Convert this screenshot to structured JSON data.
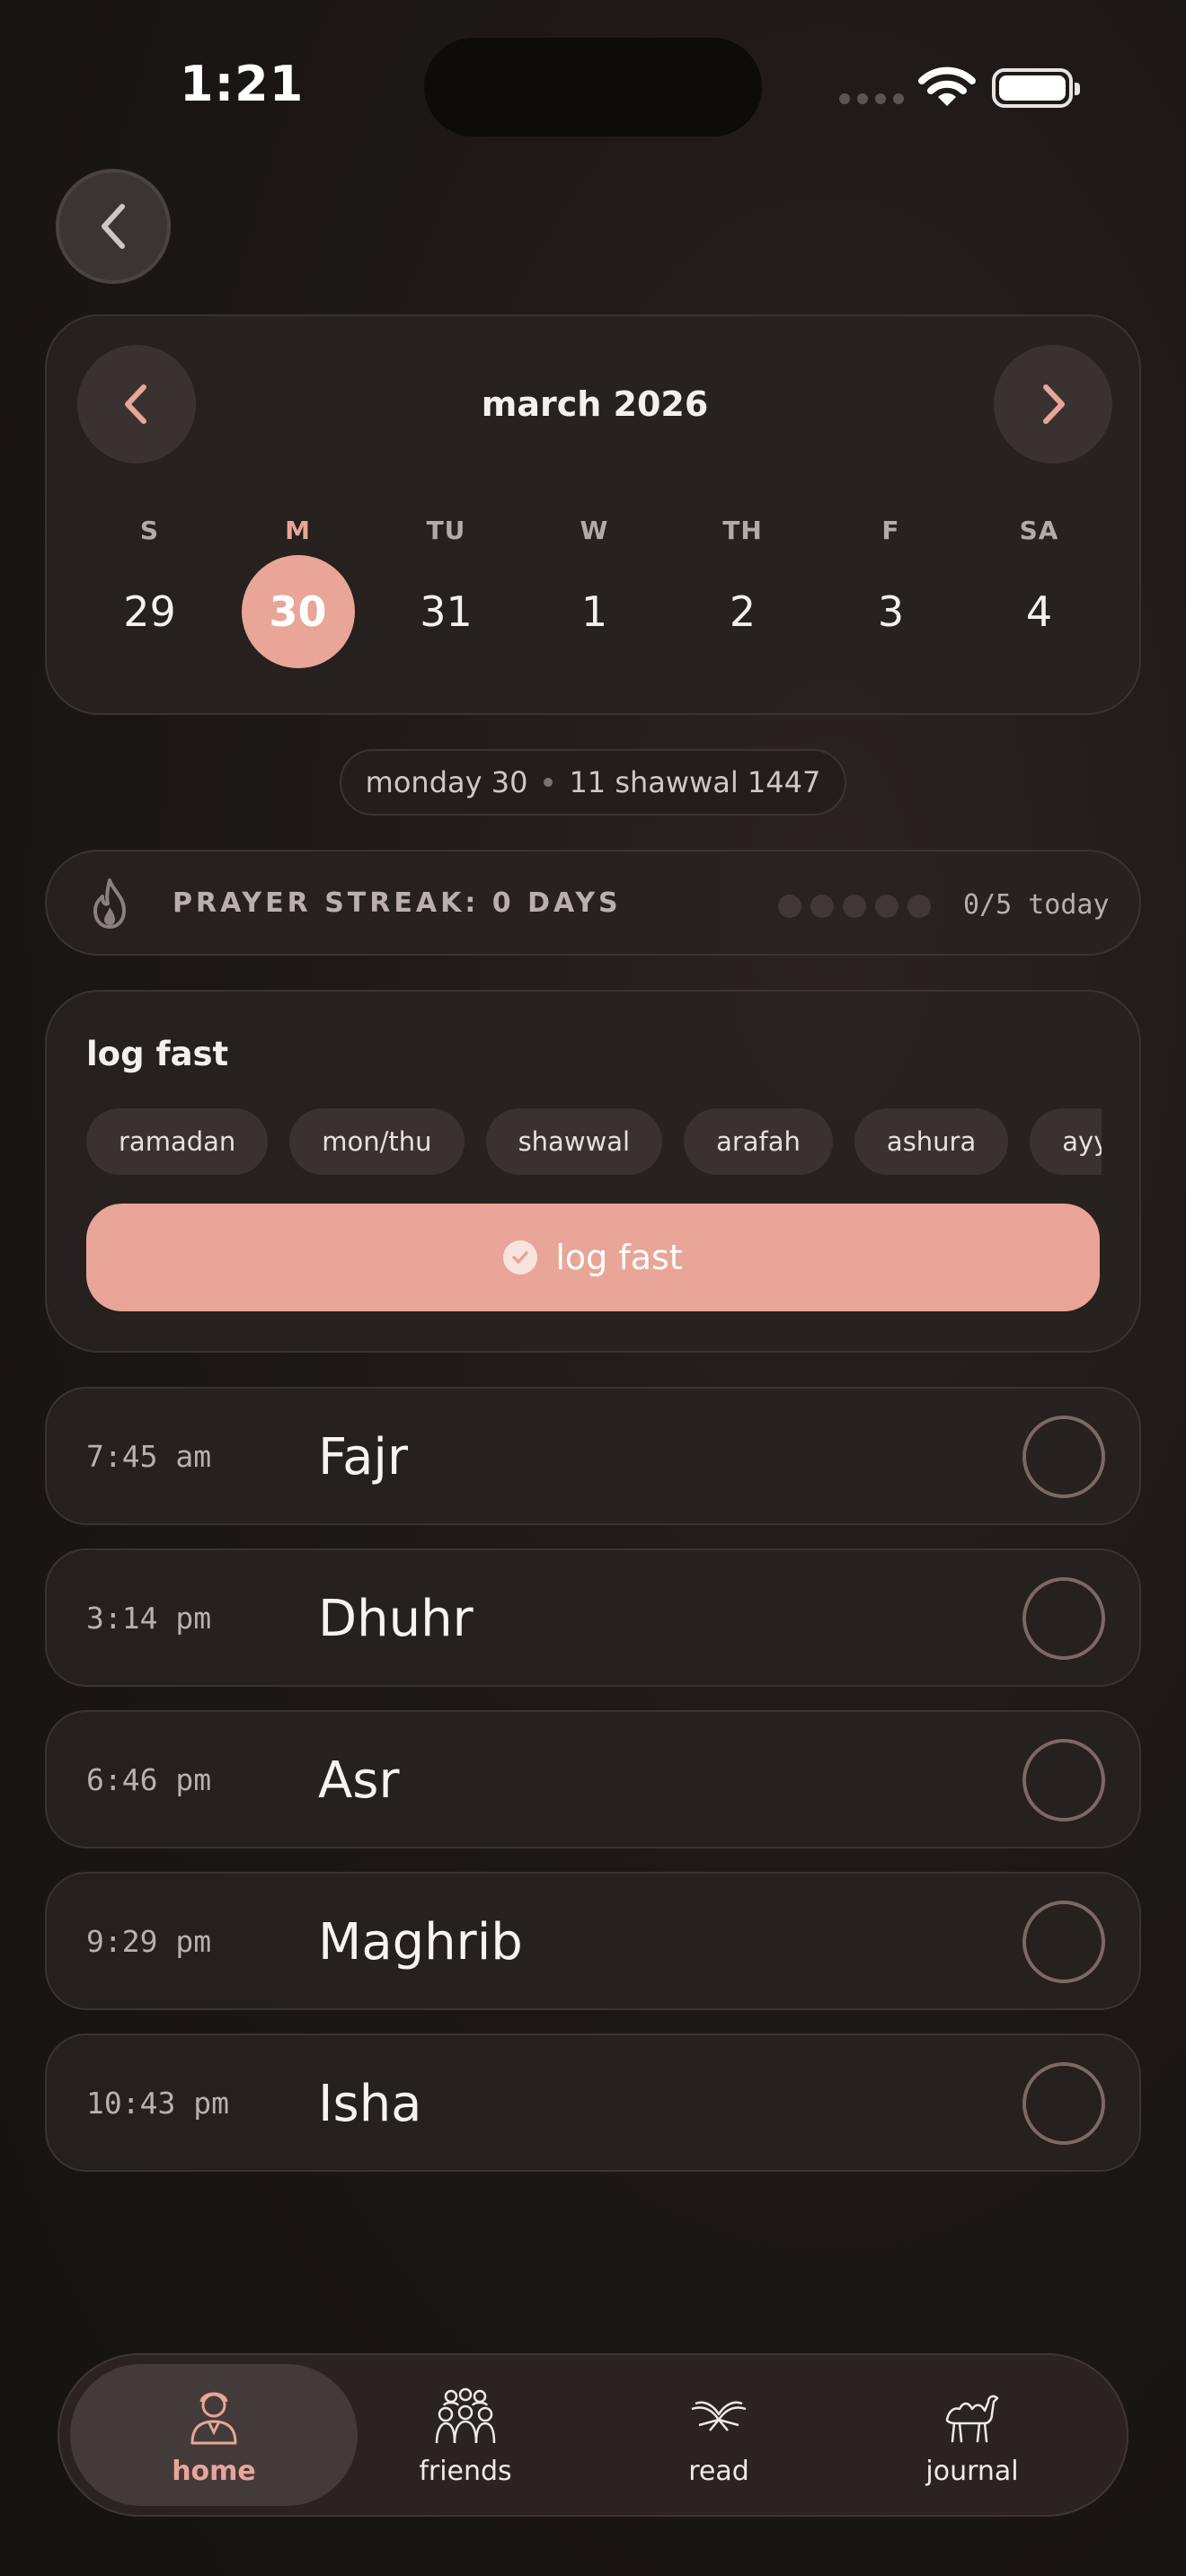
{
  "status_bar": {
    "time": "1:21"
  },
  "calendar": {
    "month_title": "march 2026",
    "weekdays": [
      "S",
      "M",
      "TU",
      "W",
      "TH",
      "F",
      "SA"
    ],
    "dates": [
      "29",
      "30",
      "31",
      "1",
      "2",
      "3",
      "4"
    ],
    "selected_index": 1,
    "accent_color": "#e9a598"
  },
  "date_info": {
    "gregorian": "monday 30",
    "hijri": "11 shawwal 1447"
  },
  "streak": {
    "label": "PRAYER STREAK: 0 DAYS",
    "completed": 0,
    "total": 5,
    "count_text": "0/5 today"
  },
  "log_fast": {
    "title": "log fast",
    "chips": [
      "ramadan",
      "mon/thu",
      "shawwal",
      "arafah",
      "ashura",
      "ayy"
    ],
    "button_label": "log fast"
  },
  "prayers": [
    {
      "time": "7:45 am",
      "name": "Fajr",
      "done": false
    },
    {
      "time": "3:14 pm",
      "name": "Dhuhr",
      "done": false
    },
    {
      "time": "6:46 pm",
      "name": "Asr",
      "done": false
    },
    {
      "time": "9:29 pm",
      "name": "Maghrib",
      "done": false
    },
    {
      "time": "10:43 pm",
      "name": "Isha",
      "done": false
    }
  ],
  "tabs": [
    {
      "label": "home",
      "icon": "person-icon",
      "active": true
    },
    {
      "label": "friends",
      "icon": "group-icon",
      "active": false
    },
    {
      "label": "read",
      "icon": "open-book-icon",
      "active": false
    },
    {
      "label": "journal",
      "icon": "camel-icon",
      "active": false
    }
  ]
}
